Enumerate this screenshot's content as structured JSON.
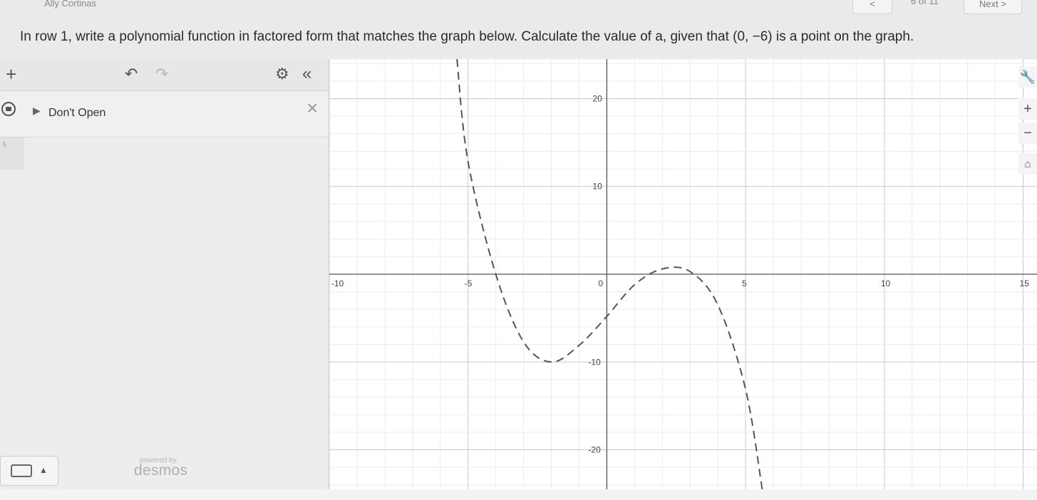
{
  "header": {
    "student_name": "Ally Cortinas",
    "prev_label": "<",
    "page_count": "6 of 11",
    "next_label": "Next >"
  },
  "instructions": "In row 1, write a polynomial function in factored form that matches the graph below. Calculate the value of a, given that (0, −6) is a point on the graph.",
  "calculator": {
    "toolbar": {
      "add_icon": "plus-icon",
      "undo_icon": "undo-icon",
      "redo_icon": "redo-icon",
      "settings_icon": "gear-icon",
      "collapse_icon": "double-chevron-left-icon"
    },
    "expressions": [
      {
        "type": "folder",
        "label": "Don't Open",
        "collapsed": true
      }
    ],
    "row_index": "5",
    "powered_by": "powered by",
    "brand": "desmos"
  },
  "graph": {
    "x_range": [
      -10,
      15.5
    ],
    "y_range": [
      -24.5,
      24.5
    ],
    "x_ticks": [
      "-10",
      "-5",
      "0",
      "5",
      "10",
      "15"
    ],
    "y_ticks": [
      "20",
      "10",
      "-10",
      "-20"
    ],
    "curve": {
      "style": "dashed",
      "color": "#555555",
      "points": [
        [
          -5.4,
          24.5
        ],
        [
          -5,
          12.8
        ],
        [
          -4,
          0
        ],
        [
          -3,
          -7.7
        ],
        [
          -2,
          -10
        ],
        [
          -1,
          -8.1
        ],
        [
          0,
          -4.8
        ],
        [
          1,
          -1.2
        ],
        [
          2,
          0.6
        ],
        [
          3,
          0.3
        ],
        [
          4,
          -3.5
        ],
        [
          5,
          -13.1
        ],
        [
          5.6,
          -24.5
        ]
      ]
    },
    "side_tools": [
      "wrench-icon",
      "zoom-in-icon",
      "zoom-out-icon",
      "home-icon"
    ]
  }
}
